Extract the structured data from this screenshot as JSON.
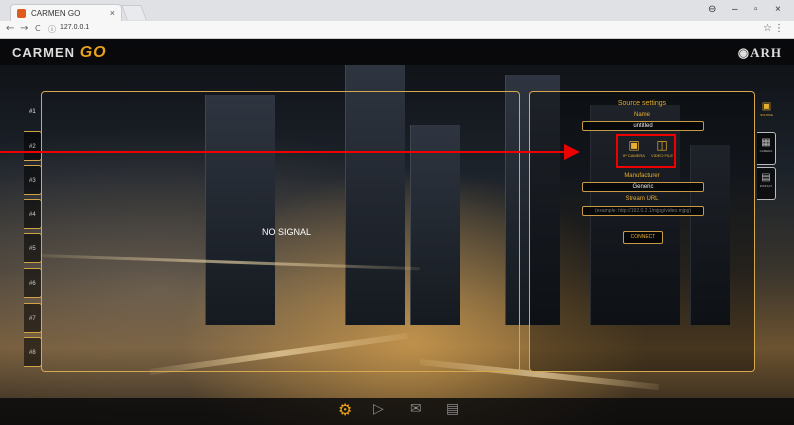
{
  "browser": {
    "tab_title": "CARMEN GO",
    "tab_close": "×",
    "url": "127.0.0.1",
    "nav_back": "←",
    "nav_forward": "→",
    "nav_reload": "C",
    "nav_info": "ⓘ",
    "star": "☆",
    "menu": "⋮",
    "win_account": "⊖",
    "win_min": "–",
    "win_max": "▫",
    "win_close": "×"
  },
  "header": {
    "logo_text": "CARMEN",
    "logo_accent": "GO",
    "brand_right": "ARH"
  },
  "left_tabs": [
    "#1",
    "#2",
    "#3",
    "#4",
    "#5",
    "#6",
    "#7",
    "#8"
  ],
  "video": {
    "status": "NO SIGNAL"
  },
  "settings": {
    "title": "Source settings",
    "name_label": "Name",
    "name_value": "untitled",
    "source_types": [
      {
        "label": "IP CAMERA",
        "icon": "camera-icon"
      },
      {
        "label": "VIDEO FILE",
        "icon": "video-file-icon"
      }
    ],
    "manufacturer_label": "Manufacturer",
    "manufacturer_value": "Generic",
    "stream_label": "Stream URL",
    "stream_placeholder": "(example: http://192.0.2.1/mjpg/video.mjpg)",
    "connect_label": "CONNECT"
  },
  "right_tabs": [
    {
      "label": "SOURCE",
      "icon": "camera-icon"
    },
    {
      "label": "CAMERA",
      "icon": "camera-settings-icon"
    },
    {
      "label": "DISPLAY",
      "icon": "display-icon"
    }
  ],
  "footer_icons": [
    "gear-icon",
    "play-icon",
    "chat-icon",
    "message-icon"
  ],
  "colors": {
    "accent": "#e8b030",
    "highlight": "#e00000"
  }
}
